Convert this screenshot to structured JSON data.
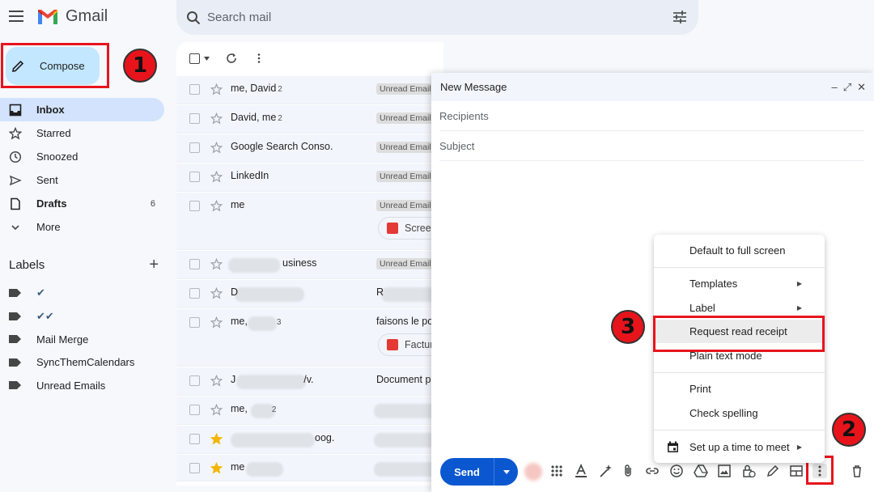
{
  "app": {
    "logo_text": "Gmail"
  },
  "search": {
    "placeholder": "Search mail"
  },
  "sidebar": {
    "compose_label": "Compose",
    "items": [
      {
        "label": "Inbox",
        "icon": "inbox-icon",
        "count": ""
      },
      {
        "label": "Starred",
        "icon": "star-icon",
        "count": ""
      },
      {
        "label": "Snoozed",
        "icon": "clock-icon",
        "count": ""
      },
      {
        "label": "Sent",
        "icon": "send-icon",
        "count": ""
      },
      {
        "label": "Drafts",
        "icon": "draft-icon",
        "count": "6"
      },
      {
        "label": "More",
        "icon": "chevron-down-icon",
        "count": ""
      }
    ],
    "labels_title": "Labels",
    "labels": [
      "✔",
      "✔✔",
      "Mail Merge",
      "SyncThemCalendars",
      "Unread Emails"
    ]
  },
  "mail_list": {
    "rows": [
      {
        "sender": "me, David",
        "count": "2",
        "tag": "Unread Email",
        "subject": "",
        "starred": false
      },
      {
        "sender": "David, me",
        "count": "2",
        "tag": "Unread Email",
        "subject": "",
        "starred": false
      },
      {
        "sender": "Google Search Conso.",
        "count": "",
        "tag": "Unread Email",
        "subject": "",
        "starred": false
      },
      {
        "sender": "LinkedIn",
        "count": "",
        "tag": "Unread Email",
        "subject": "",
        "starred": false
      },
      {
        "sender": "me",
        "count": "",
        "tag": "Unread Email",
        "subject": "",
        "attachment": "Scree",
        "starred": false
      },
      {
        "sender": "usiness",
        "count": "",
        "tag": "Unread Email",
        "subject": "",
        "starred": false
      },
      {
        "sender": "D",
        "count": "",
        "tag": "",
        "subject": "R",
        "starred": false
      },
      {
        "sender": "me,",
        "count": "3",
        "tag": "",
        "subject": "faisons le po",
        "attachment": "Factur",
        "starred": false
      },
      {
        "sender": "J",
        "count": "",
        "tag": "",
        "subject": "Document p",
        "sender_tail": "/v.",
        "starred": false
      },
      {
        "sender": "me,",
        "count": "2",
        "tag": "",
        "subject": "",
        "starred": false
      },
      {
        "sender": "",
        "count": "",
        "tag": "",
        "subject": "",
        "sender_tail": "oog.",
        "starred": true
      },
      {
        "sender": "me",
        "count": "",
        "tag": "",
        "subject": "",
        "starred": true
      }
    ]
  },
  "compose_window": {
    "title": "New Message",
    "recipients_placeholder": "Recipients",
    "subject_placeholder": "Subject",
    "send_label": "Send"
  },
  "more_menu": {
    "items": [
      {
        "label": "Default to full screen",
        "has_arrow": false
      },
      {
        "label": "Templates",
        "has_arrow": true
      },
      {
        "label": "Label",
        "has_arrow": true
      },
      {
        "label": "Request read receipt",
        "has_arrow": false
      },
      {
        "label": "Plain text mode",
        "has_arrow": false
      },
      {
        "label": "Print",
        "has_arrow": false
      },
      {
        "label": "Check spelling",
        "has_arrow": false
      },
      {
        "label": "Set up a time to meet",
        "has_arrow": true
      }
    ]
  },
  "callouts": {
    "step1": "1",
    "step2": "2",
    "step3": "3"
  },
  "colors": {
    "highlight": "#e8141c",
    "compose_bg": "#c2e7ff",
    "send_bg": "#0b57d0",
    "active_nav": "#d3e3fd"
  }
}
